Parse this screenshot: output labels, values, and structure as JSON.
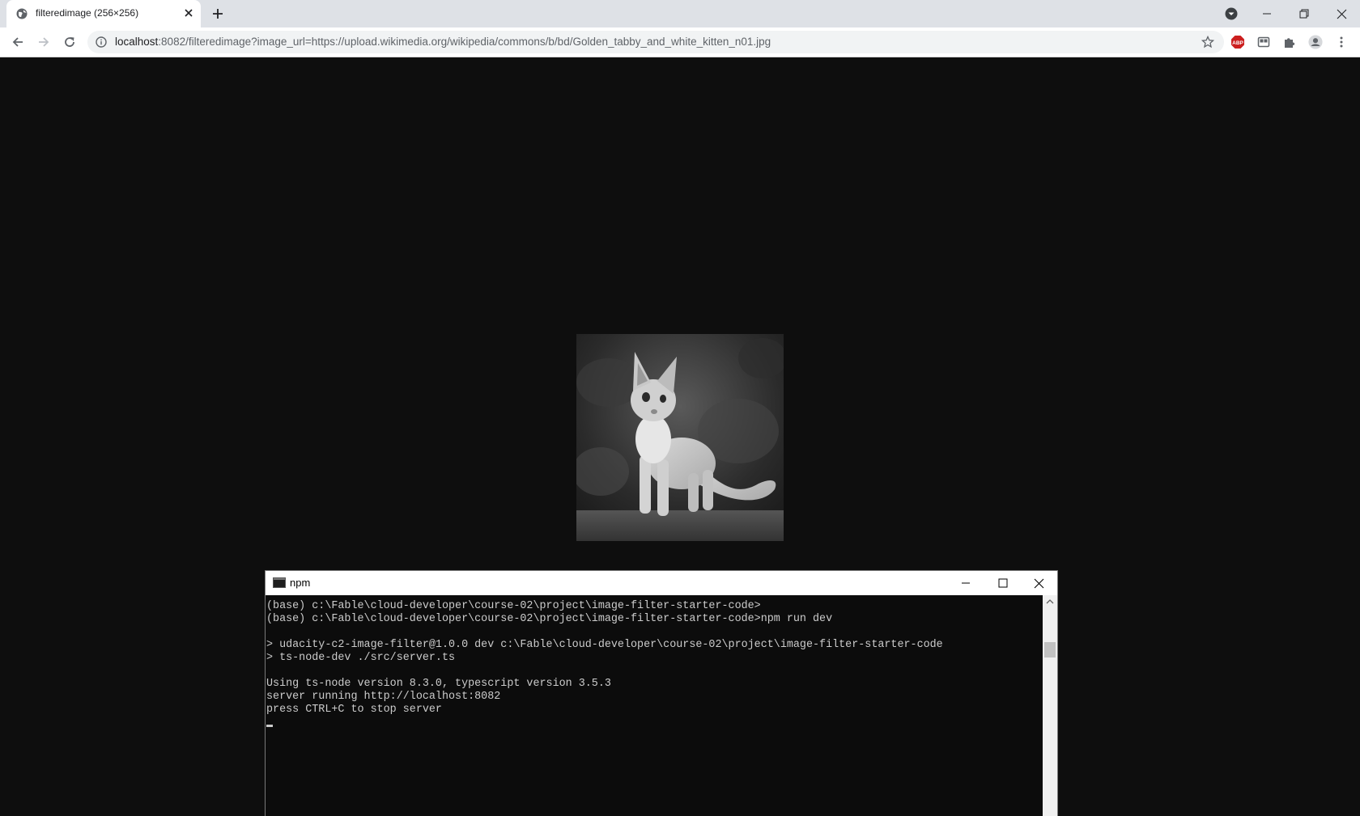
{
  "browser": {
    "tab": {
      "title": "filteredimage (256×256)"
    },
    "address": {
      "host": "localhost",
      "rest": ":8082/filteredimage?image_url=https://upload.wikimedia.org/wikipedia/commons/b/bd/Golden_tabby_and_white_kitten_n01.jpg"
    },
    "extensions": {
      "adblock_label": "ABP"
    }
  },
  "image": {
    "alt": "filtered image",
    "filter": "grayscale"
  },
  "terminal": {
    "title": "npm",
    "lines": [
      "(base) c:\\Fable\\cloud-developer\\course-02\\project\\image-filter-starter-code>",
      "(base) c:\\Fable\\cloud-developer\\course-02\\project\\image-filter-starter-code>npm run dev",
      "",
      "> udacity-c2-image-filter@1.0.0 dev c:\\Fable\\cloud-developer\\course-02\\project\\image-filter-starter-code",
      "> ts-node-dev ./src/server.ts",
      "",
      "Using ts-node version 8.3.0, typescript version 3.5.3",
      "server running http://localhost:8082",
      "press CTRL+C to stop server"
    ]
  },
  "colors": {
    "page_background": "#0e0e0e",
    "terminal_background": "#0c0c0c",
    "terminal_text": "#cccccc",
    "adblock": "#cc1f1f"
  }
}
